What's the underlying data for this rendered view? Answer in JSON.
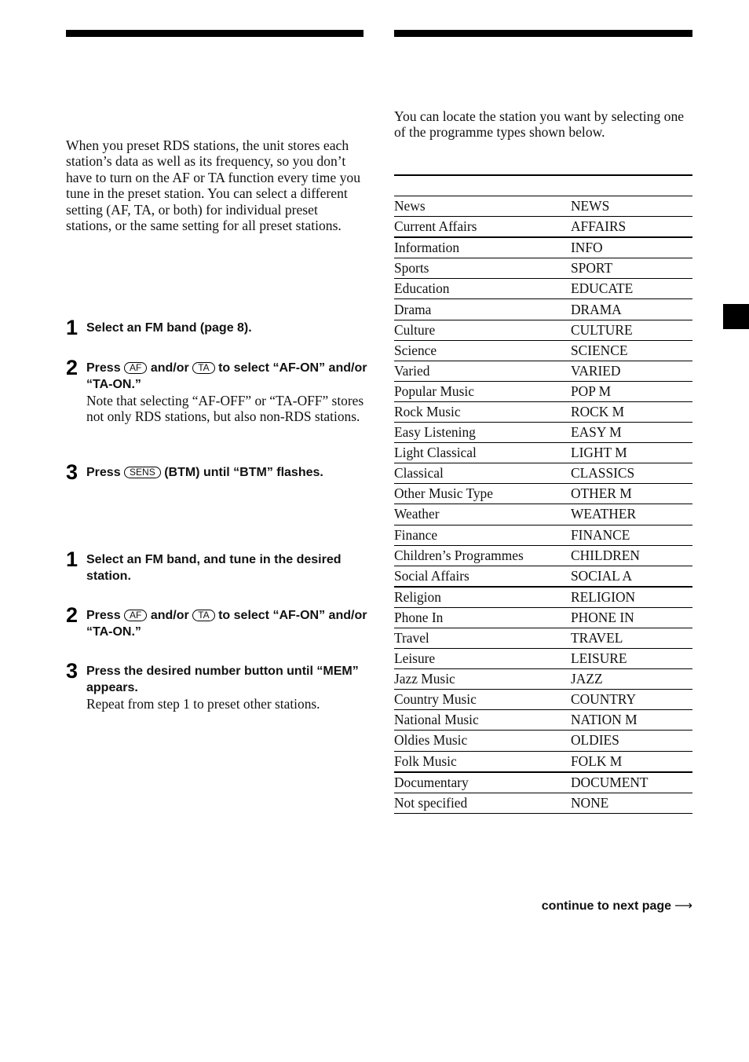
{
  "left_column": {
    "intro": "When you preset RDS stations, the unit stores each station’s data as well as its frequency, so you don’t have to turn on the AF or TA function every time you tune in the preset station. You can select a different setting (AF, TA, or both) for individual preset stations, or the same setting for all preset stations.",
    "procedure_all": [
      {
        "number": "1",
        "title": "Select an FM band (page 8)."
      },
      {
        "number": "2",
        "title_pre": "Press",
        "key1": "AF",
        "title_mid": "and/or",
        "key2": "TA",
        "title_post": "to select “AF-ON” and/or “TA-ON.”",
        "note": "Note that selecting “AF-OFF” or “TA-OFF” stores not only RDS stations, but also non-RDS stations."
      },
      {
        "number": "3",
        "title_pre": "Press",
        "key1": "SENS",
        "title_post": "(BTM) until “BTM” flashes."
      }
    ],
    "procedure_individual": [
      {
        "number": "1",
        "title": "Select an FM band, and tune in the desired station."
      },
      {
        "number": "2",
        "title_pre": "Press",
        "key1": "AF",
        "title_mid": "and/or",
        "key2": "TA",
        "title_post": "to select “AF-ON” and/or “TA-ON.”"
      },
      {
        "number": "3",
        "title": "Press the desired number button until “MEM” appears.",
        "note": "Repeat from step 1 to preset other stations."
      }
    ]
  },
  "right_column": {
    "intro": "You can locate the station you want by selecting one of the programme types shown below.",
    "programme_types": [
      {
        "type": "News",
        "display": "NEWS"
      },
      {
        "type": "Current Affairs",
        "display": "AFFAIRS"
      },
      {
        "type": "Information",
        "display": "INFO"
      },
      {
        "type": "Sports",
        "display": "SPORT"
      },
      {
        "type": "Education",
        "display": "EDUCATE"
      },
      {
        "type": "Drama",
        "display": "DRAMA"
      },
      {
        "type": "Culture",
        "display": "CULTURE"
      },
      {
        "type": "Science",
        "display": "SCIENCE"
      },
      {
        "type": "Varied",
        "display": "VARIED"
      },
      {
        "type": "Popular Music",
        "display": "POP M"
      },
      {
        "type": "Rock Music",
        "display": "ROCK M"
      },
      {
        "type": "Easy Listening",
        "display": "EASY M"
      },
      {
        "type": "Light Classical",
        "display": "LIGHT M"
      },
      {
        "type": "Classical",
        "display": "CLASSICS"
      },
      {
        "type": "Other Music Type",
        "display": "OTHER M"
      },
      {
        "type": "Weather",
        "display": "WEATHER"
      },
      {
        "type": "Finance",
        "display": "FINANCE"
      },
      {
        "type": "Children’s Programmes",
        "display": "CHILDREN"
      },
      {
        "type": "Social Affairs",
        "display": "SOCIAL A"
      },
      {
        "type": "Religion",
        "display": "RELIGION"
      },
      {
        "type": "Phone In",
        "display": "PHONE IN"
      },
      {
        "type": "Travel",
        "display": "TRAVEL"
      },
      {
        "type": "Leisure",
        "display": "LEISURE"
      },
      {
        "type": "Jazz Music",
        "display": "JAZZ"
      },
      {
        "type": "Country Music",
        "display": "COUNTRY"
      },
      {
        "type": "National Music",
        "display": "NATION M"
      },
      {
        "type": "Oldies Music",
        "display": "OLDIES"
      },
      {
        "type": "Folk Music",
        "display": "FOLK M"
      },
      {
        "type": "Documentary",
        "display": "DOCUMENT"
      },
      {
        "type": "Not specified",
        "display": "NONE"
      }
    ],
    "continue_label": "continue to next page",
    "continue_icon": "arrow-right-icon"
  }
}
